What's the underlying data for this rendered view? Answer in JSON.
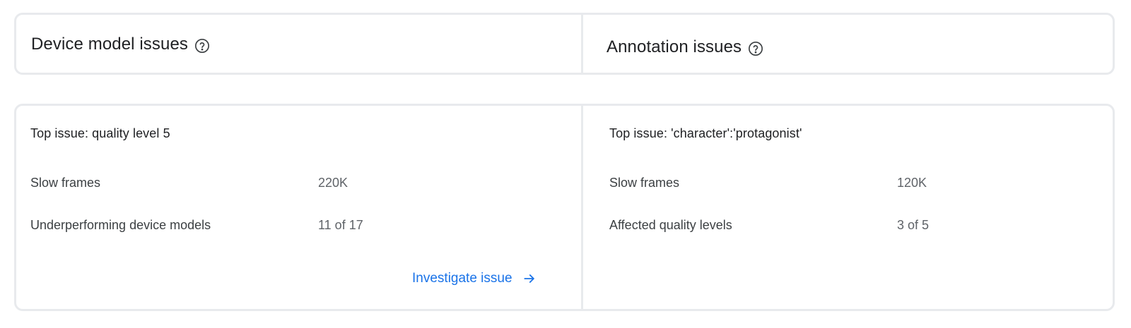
{
  "header": {
    "left_title": "Device model issues",
    "right_title": "Annotation issues"
  },
  "device_model": {
    "top_issue": "Top issue: quality level 5",
    "metrics": [
      {
        "label": "Slow frames",
        "value": "220K"
      },
      {
        "label": "Underperforming device models",
        "value": "11 of 17"
      }
    ],
    "link_label": "Investigate issue"
  },
  "annotation": {
    "top_issue": "Top issue: 'character':'protagonist'",
    "metrics": [
      {
        "label": "Slow frames",
        "value": "120K"
      },
      {
        "label": "Affected quality levels",
        "value": "3 of 5"
      }
    ]
  },
  "icons": {
    "help": "help-circle-icon",
    "arrow": "arrow-right-icon"
  },
  "colors": {
    "link": "#1a73e8",
    "border": "#e8eaed",
    "text": "#202124",
    "value_text": "#5f6368"
  }
}
